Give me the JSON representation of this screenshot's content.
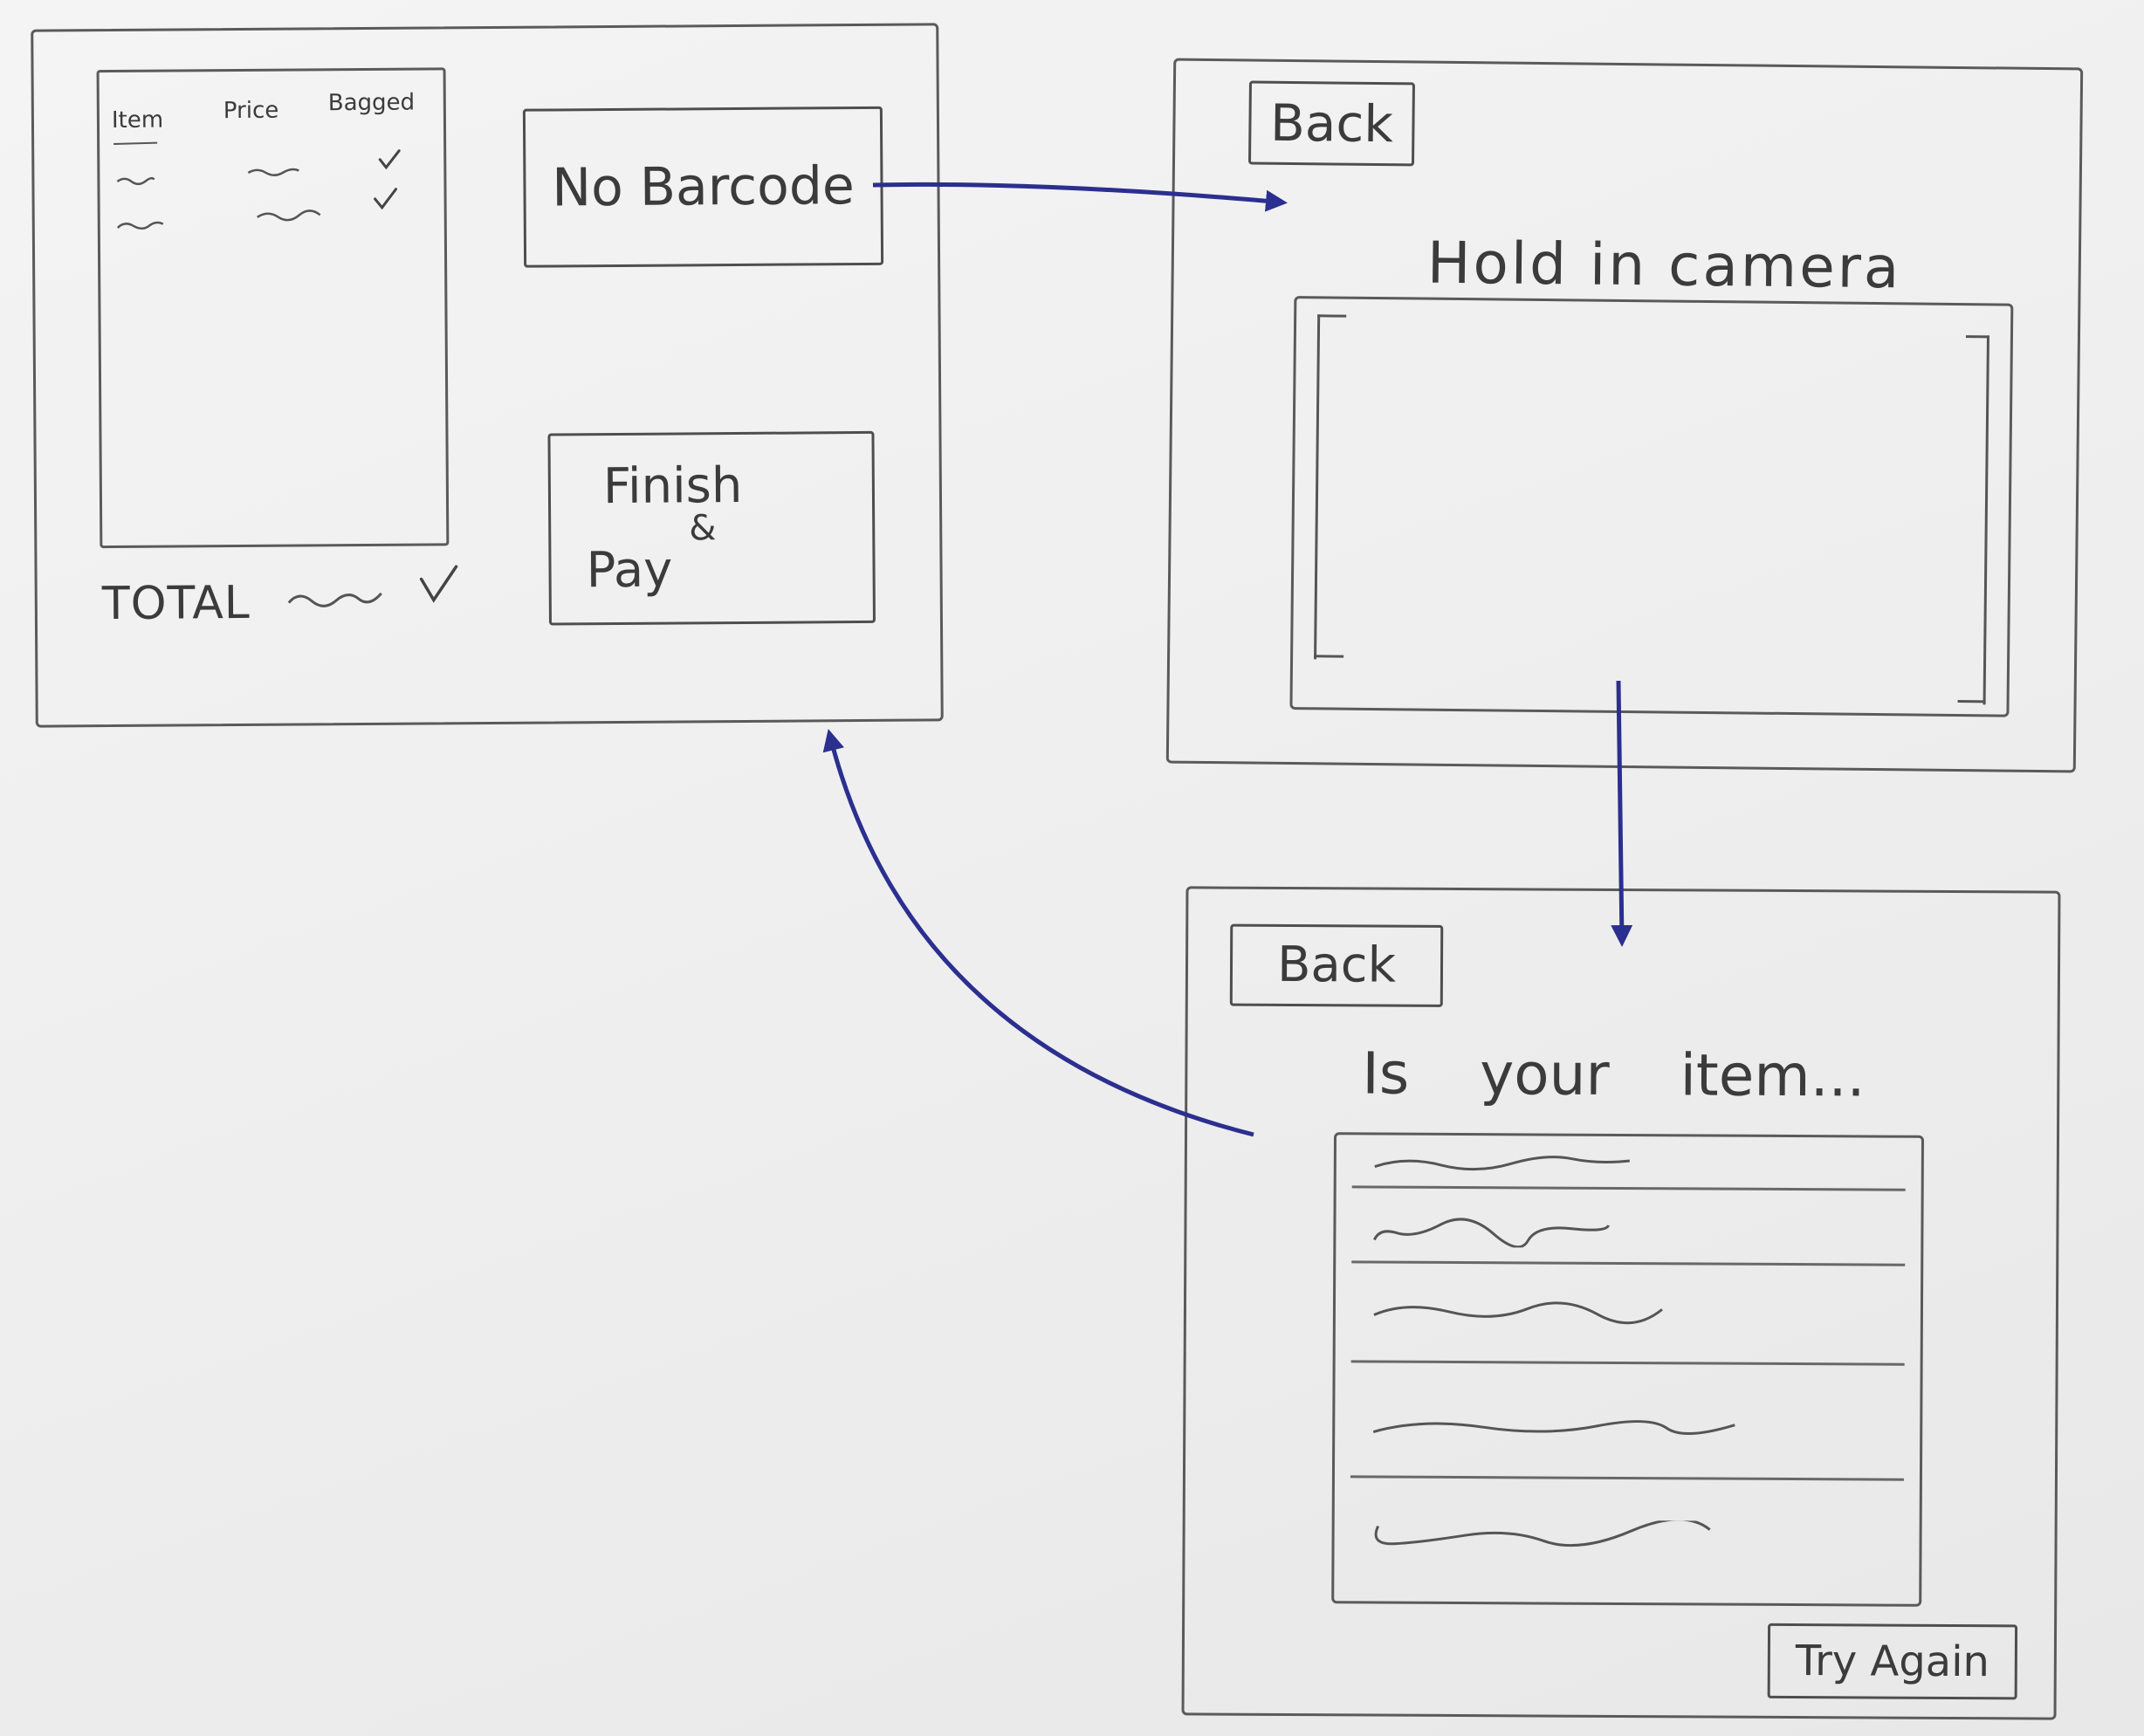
{
  "screens": {
    "cart": {
      "table": {
        "columns": [
          "Item",
          "Price",
          "Bagged"
        ],
        "row_count_visible": 2
      },
      "total_label": "TOTAL",
      "no_barcode_button": "No Barcode",
      "finish_button": {
        "line1": "Finish",
        "line2": "&",
        "line3": "Pay"
      }
    },
    "camera": {
      "back_button": "Back",
      "instruction": "Hold in camera"
    },
    "results": {
      "back_button": "Back",
      "prompt": "Is your item...",
      "result_count_visible": 5,
      "try_again_button": "Try Again"
    }
  },
  "colors": {
    "paper": "#efefef",
    "pencil": "#4a4a4a",
    "arrow_ink": "#2b2f8f"
  },
  "icons": {
    "bagged_check": "check-icon",
    "flow_arrow": "arrow-right-icon"
  }
}
